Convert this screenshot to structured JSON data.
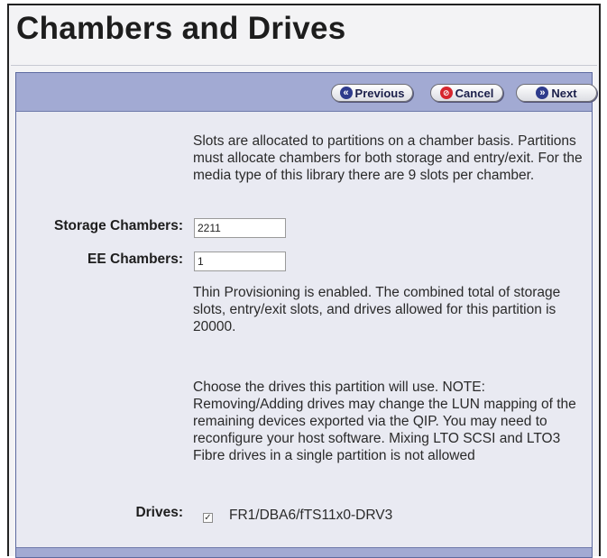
{
  "page": {
    "title": "Chambers and Drives"
  },
  "toolbar": {
    "previous_label": "Previous",
    "cancel_label": "Cancel",
    "next_label": "Next",
    "previous_icon": "double-chevron-left-icon",
    "cancel_icon": "cancel-circle-icon",
    "next_icon": "double-chevron-right-icon"
  },
  "form": {
    "intro_text": "Slots are allocated to partitions on a chamber basis. Partitions must allocate chambers for both storage and entry/exit. For the media type of this library there are 9 slots per chamber.",
    "storage_chambers_label": "Storage Chambers:",
    "storage_chambers_value": "2211",
    "ee_chambers_label": "EE Chambers:",
    "ee_chambers_value": "1",
    "thin_provisioning_text": "Thin Provisioning is enabled. The combined total of storage slots, entry/exit slots, and drives allowed for this partition is 20000.",
    "drives_note": "Choose the drives this partition will use. NOTE: Removing/Adding drives may change the LUN mapping of the remaining devices exported via the QIP. You may need to reconfigure your host software. Mixing LTO SCSI and LTO3 Fibre drives in a single partition is not allowed",
    "drives_label": "Drives:",
    "drives": [
      {
        "name": "FR1/DBA6/fTS11x0-DRV3",
        "checked": true
      }
    ]
  },
  "colors": {
    "toolbar_bg": "#a2aad3",
    "panel_bg": "#e9eaf2",
    "button_text": "#1b1f4a",
    "cancel_icon": "#d6262e"
  }
}
